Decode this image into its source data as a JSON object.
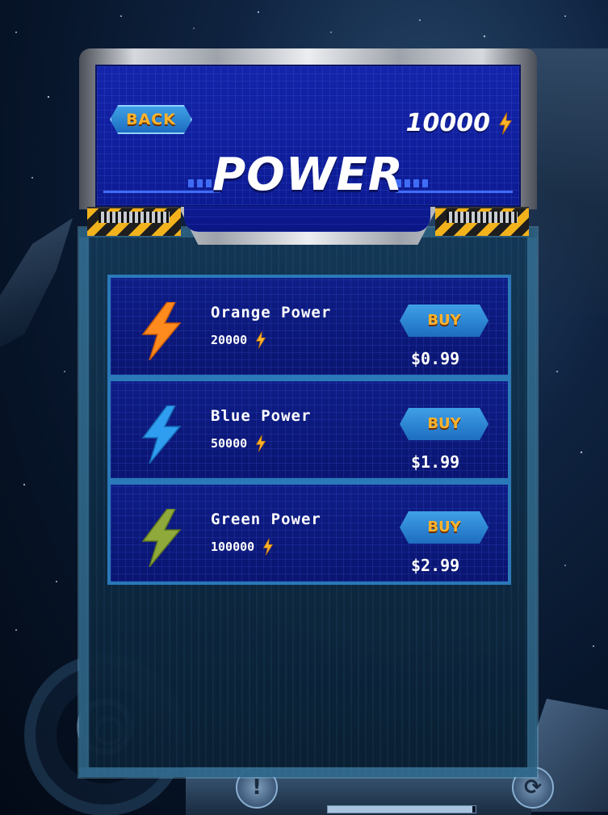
{
  "header": {
    "back_label": "BACK",
    "currency_amount": "10000",
    "currency_icon": "lightning-bolt-icon",
    "title": "POWER"
  },
  "products": [
    {
      "name": "Orange Power",
      "amount": "20000",
      "price": "$0.99",
      "buy_label": "BUY",
      "icon": "orange-lightning-icon",
      "color": "#ff8a1e"
    },
    {
      "name": "Blue Power",
      "amount": "50000",
      "price": "$1.99",
      "buy_label": "BUY",
      "icon": "blue-lightning-icon",
      "color": "#2f9df0"
    },
    {
      "name": "Green Power",
      "amount": "100000",
      "price": "$2.99",
      "buy_label": "BUY",
      "icon": "green-lightning-icon",
      "color": "#8fa93a"
    }
  ],
  "colors": {
    "accent_gold": "#ffb32a",
    "panel_blue": "#0e1d86",
    "button_blue": "#2a86d6"
  },
  "footer": {
    "progress": 0.98
  }
}
